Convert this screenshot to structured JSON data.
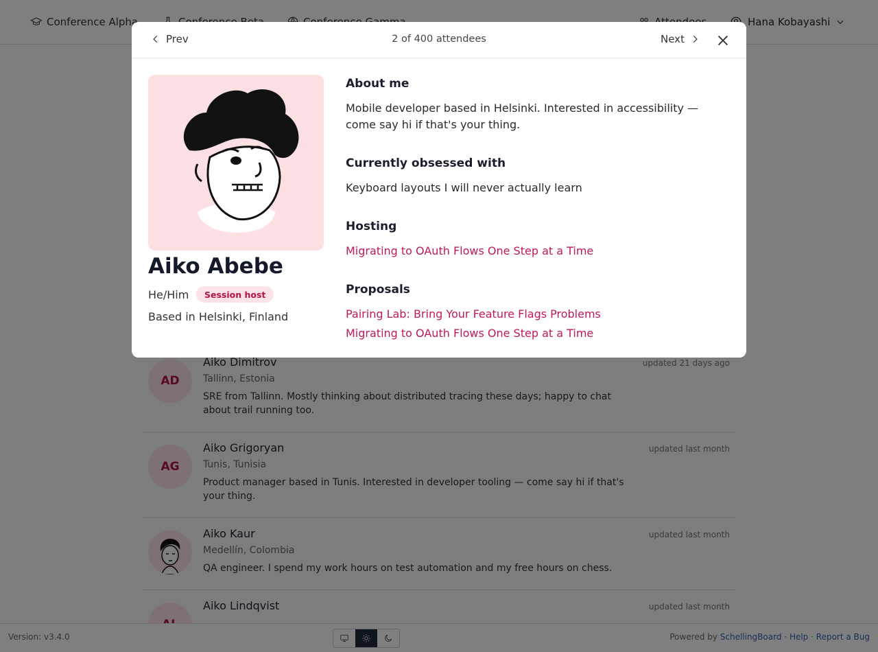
{
  "nav": {
    "conferences": [
      "Conference Alpha",
      "Conference Beta",
      "Conference Gamma"
    ],
    "attendees_label": "Attendees",
    "user_name": "Hana Kobayashi"
  },
  "list": {
    "rows": [
      {
        "initials": "AD",
        "name": "Aiko Dimitrov",
        "location": "Tallinn, Estonia",
        "bio": "SRE from Tallinn. Mostly thinking about distributed tracing these days; happy to chat about trail running too.",
        "updated": "updated 21 days ago"
      },
      {
        "initials": "AG",
        "name": "Aiko Grigoryan",
        "location": "Tunis, Tunisia",
        "bio": "Product manager based in Tunis. Interested in developer tooling — come say hi if that's your thing.",
        "updated": "updated last month"
      },
      {
        "initials": "",
        "name": "Aiko Kaur",
        "location": "Medellín, Colombia",
        "bio": "QA engineer. I spend my work hours on test automation and my free hours on chess.",
        "updated": "updated last month"
      },
      {
        "initials": "AL",
        "name": "Aiko Lindqvist",
        "location": "",
        "bio": "",
        "updated": "updated last month"
      }
    ]
  },
  "modal": {
    "prev_label": "Prev",
    "next_label": "Next",
    "counter": "2 of 400 attendees",
    "name": "Aiko Abebe",
    "pronouns": "He/Him",
    "badge": "Session host",
    "based": "Based in Helsinki, Finland",
    "about_heading": "About me",
    "about_text": "Mobile developer based in Helsinki. Interested in accessibility — come say hi if that's your thing.",
    "obsessed_heading": "Currently obsessed with",
    "obsessed_text": "Keyboard layouts I will never actually learn",
    "hosting_heading": "Hosting",
    "hosting": [
      "Migrating to OAuth Flows One Step at a Time"
    ],
    "proposals_heading": "Proposals",
    "proposals": [
      "Pairing Lab: Bring Your Feature Flags Problems",
      "Migrating to OAuth Flows One Step at a Time"
    ]
  },
  "footer": {
    "version": "Version: v3.4.0",
    "powered_prefix": "Powered by",
    "brand": "SchellingBoard",
    "help": "Help",
    "report": "Report a Bug",
    "sep": "·"
  },
  "colors": {
    "accent": "#c2185b",
    "badge_bg": "#fde2e6",
    "overlay": "rgba(0,0,0,0.5)"
  }
}
